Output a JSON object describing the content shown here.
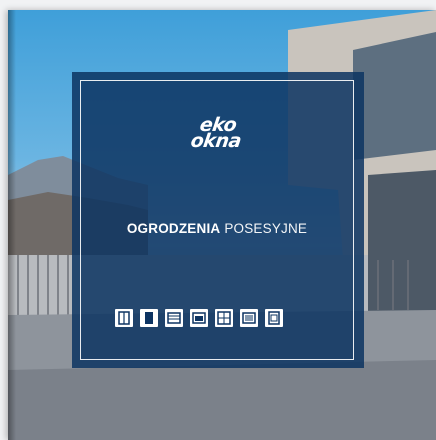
{
  "cover": {
    "brand_line1": "eko",
    "brand_line2": "okna",
    "title_bold": "OGRODZENIA",
    "title_light": "POSESYJNE"
  },
  "icons": [
    "window-single-icon",
    "door-icon",
    "shutter-icon",
    "garage-door-icon",
    "window-double-icon",
    "blinds-icon",
    "gate-icon"
  ],
  "colors": {
    "overlay": "#0d3462",
    "frame": "#ffffff",
    "icon_stroke": "#0d3462"
  }
}
